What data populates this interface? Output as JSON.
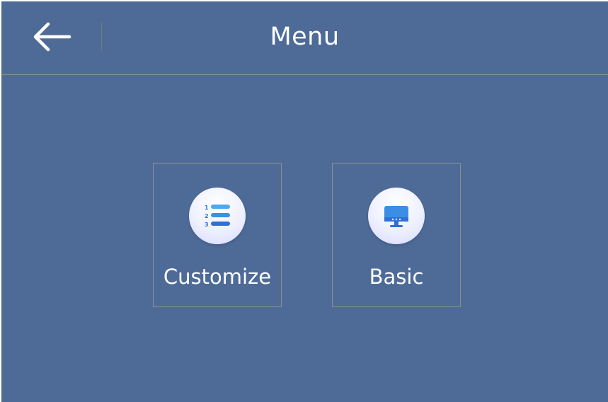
{
  "header": {
    "title": "Menu",
    "back_icon": "arrow-left-icon"
  },
  "tiles": [
    {
      "label": "Customize",
      "icon": "numbered-list-icon"
    },
    {
      "label": "Basic",
      "icon": "monitor-icon"
    }
  ],
  "colors": {
    "background": "#4e6b98",
    "text": "#ffffff",
    "icon_accent": "#3b8ee6"
  }
}
